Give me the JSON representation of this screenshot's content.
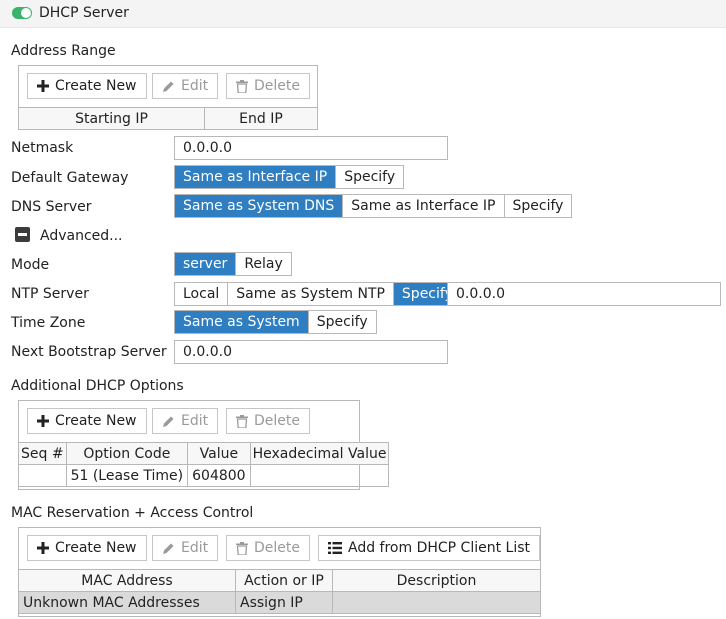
{
  "header": {
    "title": "DHCP Server",
    "toggle_on": true
  },
  "address_range": {
    "title": "Address Range",
    "toolbar": {
      "create_new": "Create New",
      "edit": "Edit",
      "delete": "Delete"
    },
    "columns": [
      "Starting IP",
      "End IP"
    ]
  },
  "fields": {
    "netmask": {
      "label": "Netmask",
      "value": "0.0.0.0"
    },
    "default_gateway": {
      "label": "Default Gateway",
      "options": [
        "Same as Interface IP",
        "Specify"
      ],
      "selected": "Same as Interface IP"
    },
    "dns_server": {
      "label": "DNS Server",
      "options": [
        "Same as System DNS",
        "Same as Interface IP",
        "Specify"
      ],
      "selected": "Same as System DNS"
    },
    "advanced": {
      "label": "Advanced..."
    },
    "mode": {
      "label": "Mode",
      "options": [
        "server",
        "Relay"
      ],
      "selected": "server"
    },
    "ntp_server": {
      "label": "NTP Server",
      "options": [
        "Local",
        "Same as System NTP",
        "Specify"
      ],
      "selected": "Specify",
      "value": "0.0.0.0"
    },
    "time_zone": {
      "label": "Time Zone",
      "options": [
        "Same as System",
        "Specify"
      ],
      "selected": "Same as System"
    },
    "next_bootstrap": {
      "label": "Next Bootstrap Server",
      "value": "0.0.0.0"
    }
  },
  "dhcp_options": {
    "title": "Additional DHCP Options",
    "toolbar": {
      "create_new": "Create New",
      "edit": "Edit",
      "delete": "Delete"
    },
    "columns": [
      "Seq #",
      "Option Code",
      "Value",
      "Hexadecimal Value"
    ],
    "rows": [
      {
        "seq": "",
        "option_code": "51 (Lease Time)",
        "value": "604800",
        "hex": ""
      }
    ]
  },
  "mac_reservation": {
    "title": "MAC Reservation + Access Control",
    "toolbar": {
      "create_new": "Create New",
      "edit": "Edit",
      "delete": "Delete",
      "add_from_client_list": "Add from DHCP Client List"
    },
    "columns": [
      "MAC Address",
      "Action or IP",
      "Description"
    ],
    "rows": [
      {
        "mac": "Unknown MAC Addresses",
        "action": "Assign IP",
        "description": ""
      }
    ]
  },
  "colors": {
    "accent": "#2f7ec1",
    "toggle_on": "#3ab36b",
    "selected_row": "#dadada"
  }
}
